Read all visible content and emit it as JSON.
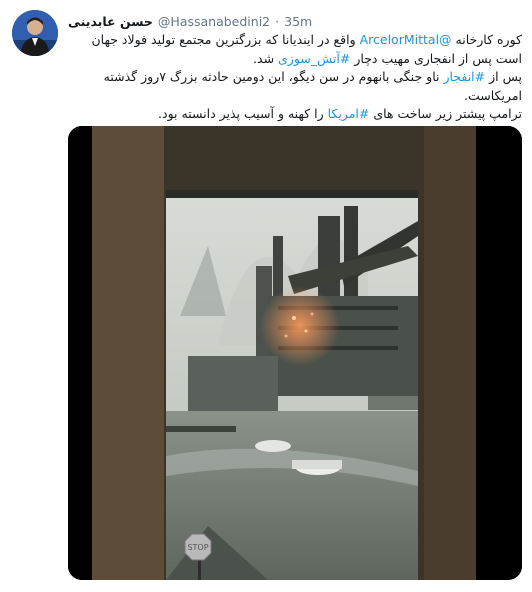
{
  "tweet": {
    "author_name": "حسن عابدینی",
    "handle": "@Hassanabedini2",
    "separator": "·",
    "time": "35m",
    "line1": {
      "prefix": "کوره کارخانه ",
      "mention": "@ArcelorMittal",
      "suffix": " واقع در ایندیانا که بزرگترین مجتمع تولید فولاد جهان"
    },
    "line2": {
      "prefix": "است پس از انفجاری مهیب دچار ",
      "hashtag": "#آتش_سوزی",
      "suffix": " شد."
    },
    "line3": {
      "prefix": "پس از ",
      "hashtag": "#انفجار",
      "suffix": " ناو جنگی بانهوم در سن دیگو، این دومین حادثه بزرگ ۷روز گذشته"
    },
    "line4": "امریکاست.",
    "line5": {
      "prefix": "ترامپ پیشتر زیر ساخت های ",
      "hashtag": "#امریکا",
      "suffix": " را کهنه و آسیب پذیر دانسته بود."
    }
  },
  "media": {
    "sign_text": "STOP"
  },
  "colors": {
    "link": "#1b95e0",
    "secondary_text": "#657786",
    "primary_text": "#14171a"
  }
}
